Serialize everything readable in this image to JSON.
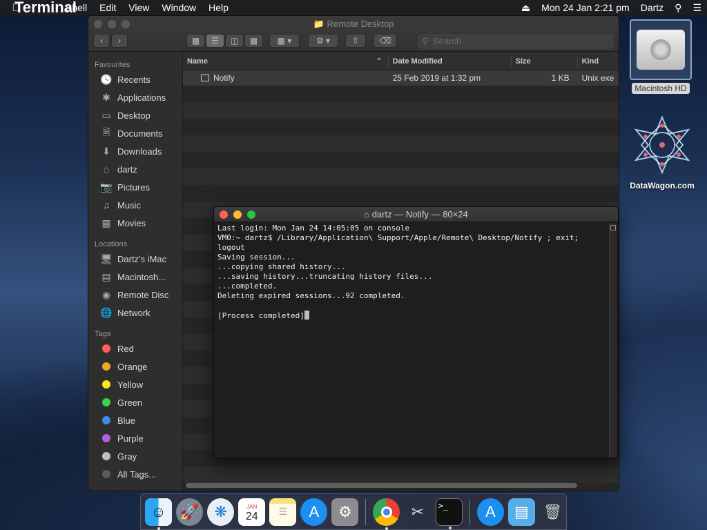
{
  "menubar": {
    "apple_icon": "apple-logo-icon",
    "app_name": "Terminal",
    "items": [
      "Shell",
      "Edit",
      "View",
      "Window",
      "Help"
    ],
    "datetime": "Mon 24 Jan  2:21 pm",
    "user": "Dartz"
  },
  "finder": {
    "title": "Remote Desktop",
    "search_placeholder": "Search",
    "sidebar": {
      "favourites_label": "Favourites",
      "favourites": [
        "Recents",
        "Applications",
        "Desktop",
        "Documents",
        "Downloads",
        "dartz",
        "Pictures",
        "Music",
        "Movies"
      ],
      "locations_label": "Locations",
      "locations": [
        "Dartz's iMac",
        "Macintosh...",
        "Remote Disc",
        "Network"
      ],
      "tags_label": "Tags",
      "tags": [
        {
          "label": "Red",
          "color": "#ff5f57"
        },
        {
          "label": "Orange",
          "color": "#f5a623"
        },
        {
          "label": "Yellow",
          "color": "#f8e71c"
        },
        {
          "label": "Green",
          "color": "#3bd34a"
        },
        {
          "label": "Blue",
          "color": "#3a8cf0"
        },
        {
          "label": "Purple",
          "color": "#b45fe3"
        },
        {
          "label": "Gray",
          "color": "#bdbdbd"
        },
        {
          "label": "All Tags...",
          "color": "#5a5a5a"
        }
      ]
    },
    "columns": {
      "name": "Name",
      "date": "Date Modified",
      "size": "Size",
      "kind": "Kind"
    },
    "files": [
      {
        "name": "Notify",
        "date": "25 Feb 2019 at 1:32 pm",
        "size": "1 KB",
        "kind": "Unix exe"
      }
    ]
  },
  "terminal": {
    "title": "dartz — Notify — 80×24",
    "lines": [
      "Last login: Mon Jan 24 14:05:05 on console",
      "VM0:~ dartz$ /Library/Application\\ Support/Apple/Remote\\ Desktop/Notify ; exit;",
      "logout",
      "Saving session...",
      "...copying shared history...",
      "...saving history...truncating history files...",
      "...completed.",
      "Deleting expired sessions...92 completed.",
      "",
      "[Process completed]"
    ]
  },
  "desktop": {
    "hd_label": "Macintosh HD",
    "datawagon_label": "DataWagon.com"
  },
  "dock": {
    "apps": [
      "finder-icon",
      "launchpad-icon",
      "safari-icon",
      "calendar-icon",
      "notes-icon",
      "app-store-icon",
      "system-preferences-icon",
      "chrome-icon",
      "screenshot-icon",
      "terminal-icon",
      "applications-folder-icon",
      "downloads-folder-icon",
      "trash-icon"
    ],
    "calendar_month": "JAN",
    "calendar_day": "24"
  }
}
